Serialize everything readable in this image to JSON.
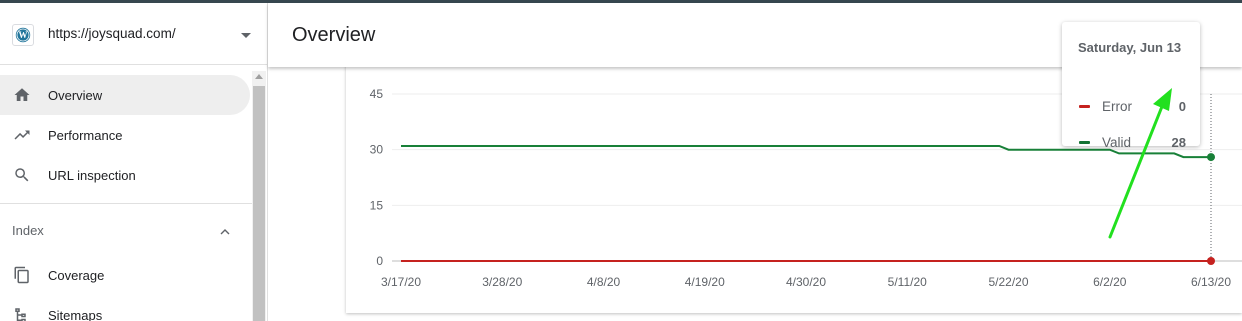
{
  "property": {
    "url": "https://joysquad.com/",
    "icon": "wordpress-icon"
  },
  "page": {
    "title": "Overview"
  },
  "nav": {
    "items": [
      {
        "label": "Overview",
        "icon": "home-icon",
        "active": true
      },
      {
        "label": "Performance",
        "icon": "trending-up-icon",
        "active": false
      },
      {
        "label": "URL inspection",
        "icon": "search-icon",
        "active": false
      }
    ],
    "index_section": {
      "label": "Index"
    },
    "index_items": [
      {
        "label": "Coverage",
        "icon": "copy-icon"
      },
      {
        "label": "Sitemaps",
        "icon": "sitemap-icon"
      }
    ]
  },
  "tooltip": {
    "date": "Saturday, Jun 13",
    "rows": [
      {
        "label": "Error",
        "value": "0",
        "color": "#c5221f"
      },
      {
        "label": "Valid",
        "value": "28",
        "color": "#137333"
      }
    ]
  },
  "colors": {
    "error": "#c5221f",
    "valid": "#188038",
    "annotation_arrow": "#22e01f"
  },
  "chart_data": {
    "type": "line",
    "y_ticks": [
      "45",
      "30",
      "15",
      "0"
    ],
    "ylim": [
      0,
      45
    ],
    "x_tick_labels": [
      "3/17/20",
      "3/28/20",
      "4/8/20",
      "4/19/20",
      "4/30/20",
      "5/11/20",
      "5/22/20",
      "6/2/20",
      "6/13/20"
    ],
    "x": [
      "2020-03-17",
      "2020-05-21",
      "2020-05-22",
      "2020-06-02",
      "2020-06-03",
      "2020-06-09",
      "2020-06-10",
      "2020-06-13"
    ],
    "series": [
      {
        "name": "Error",
        "color": "#c5221f",
        "values": [
          0,
          0,
          0,
          0,
          0,
          0,
          0,
          0
        ]
      },
      {
        "name": "Valid",
        "color": "#188038",
        "values": [
          31,
          31,
          30,
          30,
          29,
          29,
          28,
          28
        ]
      }
    ],
    "highlight_date": "2020-06-13",
    "grid": true
  }
}
